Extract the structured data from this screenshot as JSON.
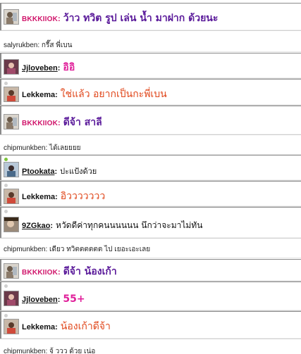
{
  "messages": [
    {
      "name": "BKKKIIOK",
      "separator": ":",
      "text": "ว้าว ทวิต รูป เล่น น้ำ มาฝาก ด้วยนะ"
    },
    {
      "text": "salyrukben: กรี๊ส พี่เบน"
    },
    {
      "name": "Jjloveben",
      "separator": ":",
      "text": "อิอิ"
    },
    {
      "name": "Lekkema",
      "separator": ":",
      "text": "ใช่แล้ว อยากเป็นกะพี่เบน"
    },
    {
      "name": "BKKKIIOK",
      "separator": ":",
      "text": "ดีจ้า สาลี"
    },
    {
      "text": "chipmunkben: ได้เลยยยย"
    },
    {
      "name": "Ptookata",
      "separator": ":",
      "text": "ปะแป้งด้วย"
    },
    {
      "name": "Lekkema",
      "separator": ":",
      "text": "อิววววววว"
    },
    {
      "name": "9ZGkao",
      "separator": ":",
      "text": "หวัดดีค่าทุกคนนนนนน นึกว่าจะมาไม่ทัน"
    },
    {
      "text": "chipmunkben: เดียว ทวิตตตตตต ไป เยอะเอะเลย"
    },
    {
      "name": "BKKKIIOK",
      "separator": ":",
      "text": "ดีจ้า น้องเก้า"
    },
    {
      "name": "Jjloveben",
      "separator": ":",
      "text": "55+"
    },
    {
      "name": "Lekkema",
      "separator": ":",
      "text": "น้องเก้าดีจ้า"
    },
    {
      "text": "chipmunkben: จ้ ววว ด้วย เน่อ"
    }
  ],
  "colors": {
    "caps_name": "#d0146a",
    "purple_text": "#5a1a9a",
    "orange_text": "#e0461a",
    "magenta_text": "#e0209a",
    "online_status": "#7cc43a",
    "offline_status": "#d0d0d0"
  }
}
